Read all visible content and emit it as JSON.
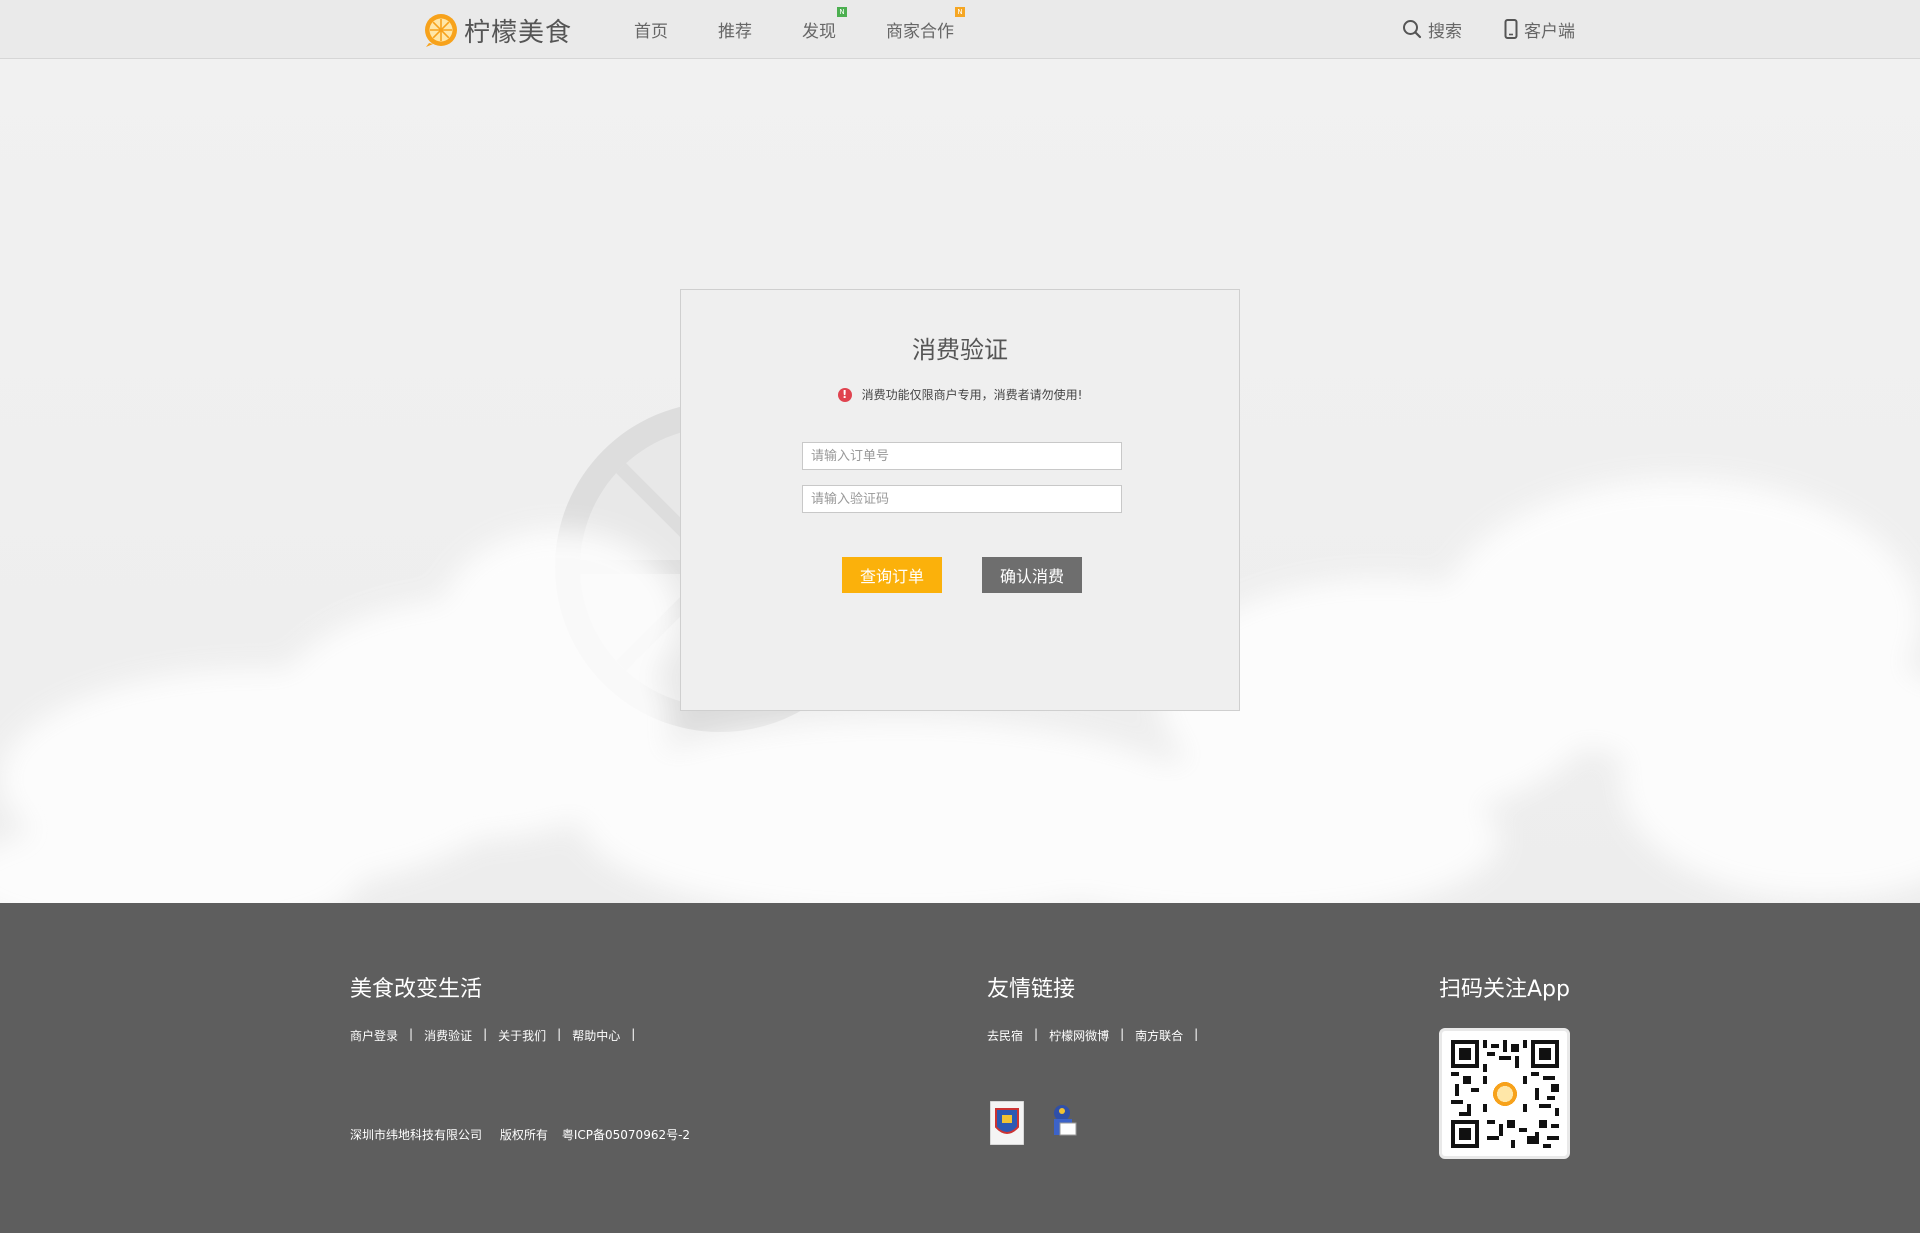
{
  "header": {
    "logo_text": "柠檬美食",
    "nav": [
      {
        "label": "首页",
        "badge": ""
      },
      {
        "label": "推荐",
        "badge": ""
      },
      {
        "label": "发现",
        "badge": "N"
      },
      {
        "label": "商家合作",
        "badge": "N"
      }
    ],
    "search_label": "搜索",
    "client_label": "客户端"
  },
  "card": {
    "title": "消费验证",
    "notice_icon": "!",
    "notice": "消费功能仅限商户专用，消费者请勿使用!",
    "order_placeholder": "请输入订单号",
    "code_placeholder": "请输入验证码",
    "query_button": "查询订单",
    "confirm_button": "确认消费"
  },
  "footer": {
    "slogan": "美食改变生活",
    "links": [
      "商户登录",
      "消费验证",
      "关于我们",
      "帮助中心"
    ],
    "friends_title": "友情链接",
    "friend_links": [
      "去民宿",
      "柠檬网微博",
      "南方联合"
    ],
    "company": "深圳市纬地科技有限公司",
    "rights": "版权所有",
    "icp": "粤ICP备05070962号-2",
    "app_title": "扫码关注App"
  },
  "colors": {
    "accent": "#fbb10b",
    "confirm": "#6e6e6e",
    "footer_bg": "#5e5e5e",
    "warning": "#e0434f"
  }
}
